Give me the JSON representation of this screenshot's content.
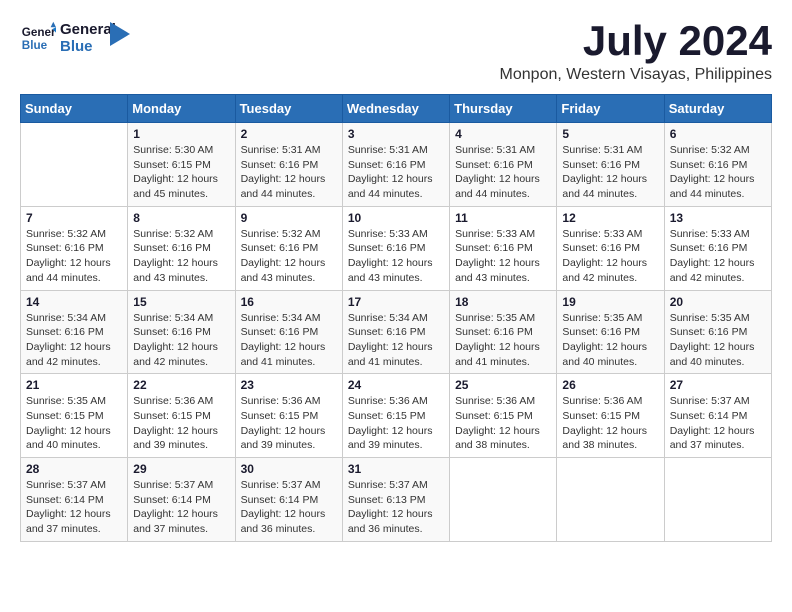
{
  "header": {
    "logo_line1": "General",
    "logo_line2": "Blue",
    "title": "July 2024",
    "subtitle": "Monpon, Western Visayas, Philippines"
  },
  "calendar": {
    "days_of_week": [
      "Sunday",
      "Monday",
      "Tuesday",
      "Wednesday",
      "Thursday",
      "Friday",
      "Saturday"
    ],
    "weeks": [
      [
        {
          "day": "",
          "info": ""
        },
        {
          "day": "1",
          "info": "Sunrise: 5:30 AM\nSunset: 6:15 PM\nDaylight: 12 hours\nand 45 minutes."
        },
        {
          "day": "2",
          "info": "Sunrise: 5:31 AM\nSunset: 6:16 PM\nDaylight: 12 hours\nand 44 minutes."
        },
        {
          "day": "3",
          "info": "Sunrise: 5:31 AM\nSunset: 6:16 PM\nDaylight: 12 hours\nand 44 minutes."
        },
        {
          "day": "4",
          "info": "Sunrise: 5:31 AM\nSunset: 6:16 PM\nDaylight: 12 hours\nand 44 minutes."
        },
        {
          "day": "5",
          "info": "Sunrise: 5:31 AM\nSunset: 6:16 PM\nDaylight: 12 hours\nand 44 minutes."
        },
        {
          "day": "6",
          "info": "Sunrise: 5:32 AM\nSunset: 6:16 PM\nDaylight: 12 hours\nand 44 minutes."
        }
      ],
      [
        {
          "day": "7",
          "info": "Sunrise: 5:32 AM\nSunset: 6:16 PM\nDaylight: 12 hours\nand 44 minutes."
        },
        {
          "day": "8",
          "info": "Sunrise: 5:32 AM\nSunset: 6:16 PM\nDaylight: 12 hours\nand 43 minutes."
        },
        {
          "day": "9",
          "info": "Sunrise: 5:32 AM\nSunset: 6:16 PM\nDaylight: 12 hours\nand 43 minutes."
        },
        {
          "day": "10",
          "info": "Sunrise: 5:33 AM\nSunset: 6:16 PM\nDaylight: 12 hours\nand 43 minutes."
        },
        {
          "day": "11",
          "info": "Sunrise: 5:33 AM\nSunset: 6:16 PM\nDaylight: 12 hours\nand 43 minutes."
        },
        {
          "day": "12",
          "info": "Sunrise: 5:33 AM\nSunset: 6:16 PM\nDaylight: 12 hours\nand 42 minutes."
        },
        {
          "day": "13",
          "info": "Sunrise: 5:33 AM\nSunset: 6:16 PM\nDaylight: 12 hours\nand 42 minutes."
        }
      ],
      [
        {
          "day": "14",
          "info": "Sunrise: 5:34 AM\nSunset: 6:16 PM\nDaylight: 12 hours\nand 42 minutes."
        },
        {
          "day": "15",
          "info": "Sunrise: 5:34 AM\nSunset: 6:16 PM\nDaylight: 12 hours\nand 42 minutes."
        },
        {
          "day": "16",
          "info": "Sunrise: 5:34 AM\nSunset: 6:16 PM\nDaylight: 12 hours\nand 41 minutes."
        },
        {
          "day": "17",
          "info": "Sunrise: 5:34 AM\nSunset: 6:16 PM\nDaylight: 12 hours\nand 41 minutes."
        },
        {
          "day": "18",
          "info": "Sunrise: 5:35 AM\nSunset: 6:16 PM\nDaylight: 12 hours\nand 41 minutes."
        },
        {
          "day": "19",
          "info": "Sunrise: 5:35 AM\nSunset: 6:16 PM\nDaylight: 12 hours\nand 40 minutes."
        },
        {
          "day": "20",
          "info": "Sunrise: 5:35 AM\nSunset: 6:16 PM\nDaylight: 12 hours\nand 40 minutes."
        }
      ],
      [
        {
          "day": "21",
          "info": "Sunrise: 5:35 AM\nSunset: 6:15 PM\nDaylight: 12 hours\nand 40 minutes."
        },
        {
          "day": "22",
          "info": "Sunrise: 5:36 AM\nSunset: 6:15 PM\nDaylight: 12 hours\nand 39 minutes."
        },
        {
          "day": "23",
          "info": "Sunrise: 5:36 AM\nSunset: 6:15 PM\nDaylight: 12 hours\nand 39 minutes."
        },
        {
          "day": "24",
          "info": "Sunrise: 5:36 AM\nSunset: 6:15 PM\nDaylight: 12 hours\nand 39 minutes."
        },
        {
          "day": "25",
          "info": "Sunrise: 5:36 AM\nSunset: 6:15 PM\nDaylight: 12 hours\nand 38 minutes."
        },
        {
          "day": "26",
          "info": "Sunrise: 5:36 AM\nSunset: 6:15 PM\nDaylight: 12 hours\nand 38 minutes."
        },
        {
          "day": "27",
          "info": "Sunrise: 5:37 AM\nSunset: 6:14 PM\nDaylight: 12 hours\nand 37 minutes."
        }
      ],
      [
        {
          "day": "28",
          "info": "Sunrise: 5:37 AM\nSunset: 6:14 PM\nDaylight: 12 hours\nand 37 minutes."
        },
        {
          "day": "29",
          "info": "Sunrise: 5:37 AM\nSunset: 6:14 PM\nDaylight: 12 hours\nand 37 minutes."
        },
        {
          "day": "30",
          "info": "Sunrise: 5:37 AM\nSunset: 6:14 PM\nDaylight: 12 hours\nand 36 minutes."
        },
        {
          "day": "31",
          "info": "Sunrise: 5:37 AM\nSunset: 6:13 PM\nDaylight: 12 hours\nand 36 minutes."
        },
        {
          "day": "",
          "info": ""
        },
        {
          "day": "",
          "info": ""
        },
        {
          "day": "",
          "info": ""
        }
      ]
    ]
  }
}
